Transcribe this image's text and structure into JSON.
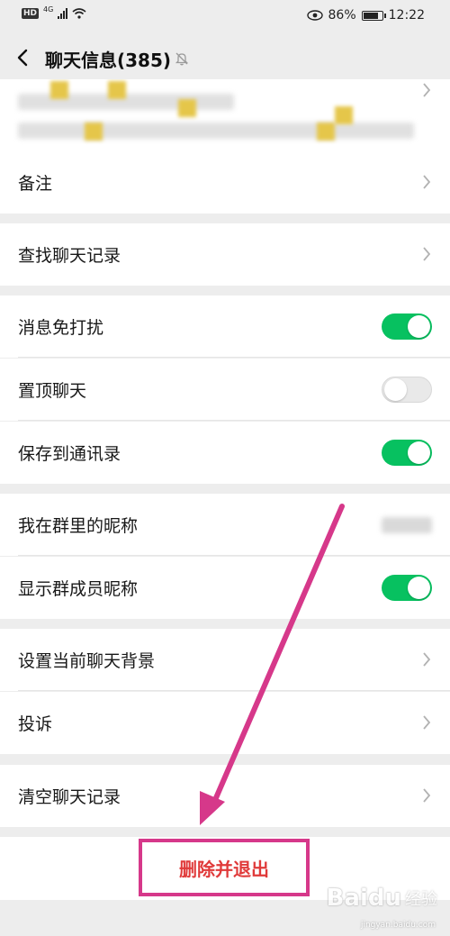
{
  "status_bar": {
    "hd": "HD",
    "network": "4G",
    "battery_percent": "86%",
    "battery_level": 0.86,
    "time": "12:22"
  },
  "nav": {
    "title": "聊天信息(385)"
  },
  "rows": {
    "remark": "备注",
    "search_history": "查找聊天记录",
    "do_not_disturb": "消息免打扰",
    "sticky_on_top": "置顶聊天",
    "save_to_contacts": "保存到通讯录",
    "my_nickname": "我在群里的昵称",
    "show_member_nicknames": "显示群成员昵称",
    "set_background": "设置当前聊天背景",
    "complain": "投诉",
    "clear_history": "清空聊天记录"
  },
  "toggles": {
    "do_not_disturb": true,
    "sticky_on_top": false,
    "save_to_contacts": true,
    "show_member_nicknames": true
  },
  "exit_button": {
    "label": "删除并退出"
  },
  "watermark": {
    "brand": "Baidu",
    "sub": "经验",
    "url": "jingyan.baidu.com"
  },
  "colors": {
    "toggle_on": "#07c160",
    "exit_text": "#e03a3a",
    "annotation": "#d6388a"
  },
  "icons": {
    "back": "back-chevron-icon",
    "mute": "bell-off-icon",
    "chevron": "chevron-right-icon",
    "eye": "eye-icon",
    "wifi": "wifi-icon"
  }
}
